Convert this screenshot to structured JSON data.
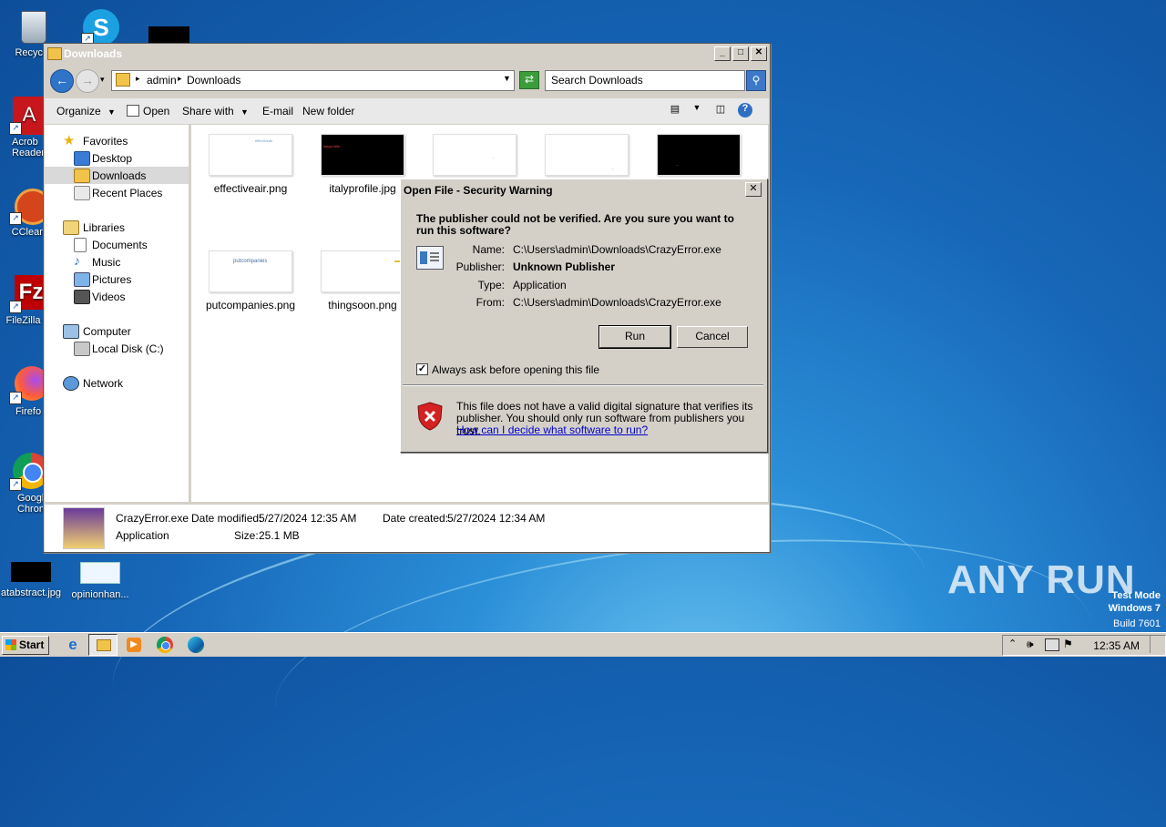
{
  "desktop": {
    "icons": [
      {
        "label": "Recycle"
      },
      {
        "label": "Acrob Reader"
      },
      {
        "label": "CClean"
      },
      {
        "label": "FileZilla C"
      },
      {
        "label": "Firefo"
      },
      {
        "label": "Googl Chrom"
      },
      {
        "label": "atabstract.jpg"
      },
      {
        "label": "opinionhan..."
      }
    ],
    "watermark": {
      "brand": "ANY RUN",
      "line1": "Test Mode",
      "line2": "Windows 7",
      "line3": "Build 7601"
    }
  },
  "explorer": {
    "title": "Downloads",
    "address": {
      "segments": [
        "admin",
        "Downloads"
      ]
    },
    "search": {
      "placeholder": "Search Downloads"
    },
    "toolbar": {
      "organize": "Organize",
      "open": "Open",
      "share_with": "Share with",
      "email": "E-mail",
      "new_folder": "New folder"
    },
    "nav": {
      "favorites": "Favorites",
      "desktop": "Desktop",
      "downloads": "Downloads",
      "recent": "Recent Places",
      "libraries": "Libraries",
      "documents": "Documents",
      "music": "Music",
      "pictures": "Pictures",
      "videos": "Videos",
      "computer": "Computer",
      "local_disk": "Local Disk (C:)",
      "network": "Network"
    },
    "files": [
      {
        "name": "effectiveair.png",
        "thumb_text": "effectiveair"
      },
      {
        "name": "italyprofile.jpg",
        "thumb_text": "italyprofile"
      },
      {
        "name": "",
        "thumb_text": "..."
      },
      {
        "name": "",
        "thumb_text": "..."
      },
      {
        "name": "",
        "thumb_text": "..."
      },
      {
        "name": "putcompanies.png",
        "thumb_text": "putcompanies"
      },
      {
        "name": "thingsoon.png",
        "thumb_text": ""
      }
    ],
    "details": {
      "filename": "CrazyError.exe",
      "type": "Application",
      "modified_label": "Date modified:",
      "modified": "5/27/2024 12:35 AM",
      "created_label": "Date created:",
      "created": "5/27/2024 12:34 AM",
      "size_label": "Size:",
      "size": "25.1 MB"
    }
  },
  "dialog": {
    "title": "Open File - Security Warning",
    "question": "The publisher could not be verified.  Are you sure you want to run this software?",
    "name_label": "Name:",
    "name": "C:\\Users\\admin\\Downloads\\CrazyError.exe",
    "publisher_label": "Publisher:",
    "publisher": "Unknown Publisher",
    "type_label": "Type:",
    "type": "Application",
    "from_label": "From:",
    "from": "C:\\Users\\admin\\Downloads\\CrazyError.exe",
    "run": "Run",
    "cancel": "Cancel",
    "always_ask": "Always ask before opening this file",
    "warning_line1": "This file does not have a valid digital signature that verifies its",
    "warning_line2": "publisher.  You should only run software from publishers you trust.",
    "help_link": "How can I decide what software to run?"
  },
  "taskbar": {
    "start": "Start",
    "clock": "12:35 AM"
  }
}
